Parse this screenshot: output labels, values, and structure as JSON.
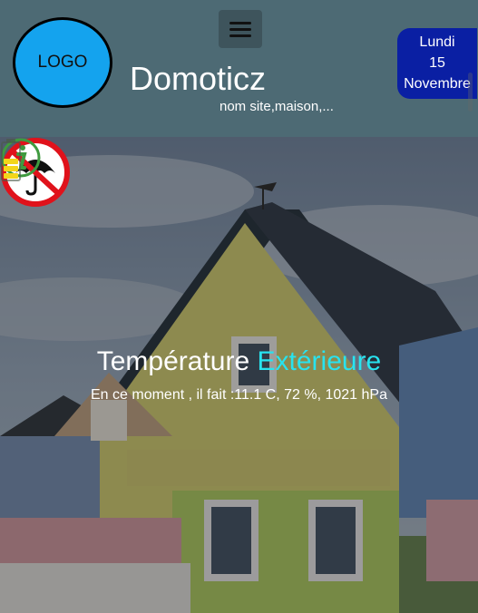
{
  "header": {
    "logo_text": "LOGO",
    "site_title": "Domoticz",
    "site_subtitle": "nom site,maison,...",
    "menu_icon": "hamburger-menu-icon"
  },
  "date": {
    "day_name": "Lundi",
    "day_number": "15",
    "month": "Novembre"
  },
  "weather": {
    "title_main": "Température",
    "title_accent": "Extérieure",
    "current_line": "En ce moment , il fait :11.1 C, 72 %, 1021 hPa",
    "rain_icon": "no-umbrella-icon",
    "accent_color": "#28e3ef"
  },
  "footer_icons": {
    "info_icon": "info-icon",
    "battery_icon": "battery-icon"
  },
  "colors": {
    "header_bg": "#4d6a74",
    "logo_bg": "#14a3ee",
    "date_bg": "#0a1fa3"
  }
}
